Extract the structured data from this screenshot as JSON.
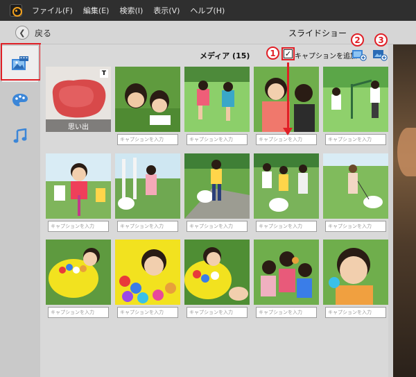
{
  "menu": [
    "ファイル(F)",
    "編集(E)",
    "検索(I)",
    "表示(V)",
    "ヘルプ(H)"
  ],
  "titlebar": {
    "back_label": "戻る",
    "title": "スライドショー"
  },
  "sidebar": [
    {
      "name": "media-tab",
      "icon": "photo-film-icon",
      "active": true
    },
    {
      "name": "theme-tab",
      "icon": "palette-icon",
      "active": false
    },
    {
      "name": "music-tab",
      "icon": "music-note-icon",
      "active": false
    }
  ],
  "media": {
    "title": "メディア (15)",
    "add_caption_label": "キャプションを追加",
    "add_caption_checked": true,
    "caption_placeholder": "キャプションを入力",
    "title_thumb_label": "思い出",
    "title_badge": "T"
  },
  "callouts": [
    "1",
    "2",
    "3"
  ],
  "colors": {
    "annotation_red": "#e01f26",
    "menubar": "#2f2f2f",
    "accent_icon": "#3b86d8"
  }
}
